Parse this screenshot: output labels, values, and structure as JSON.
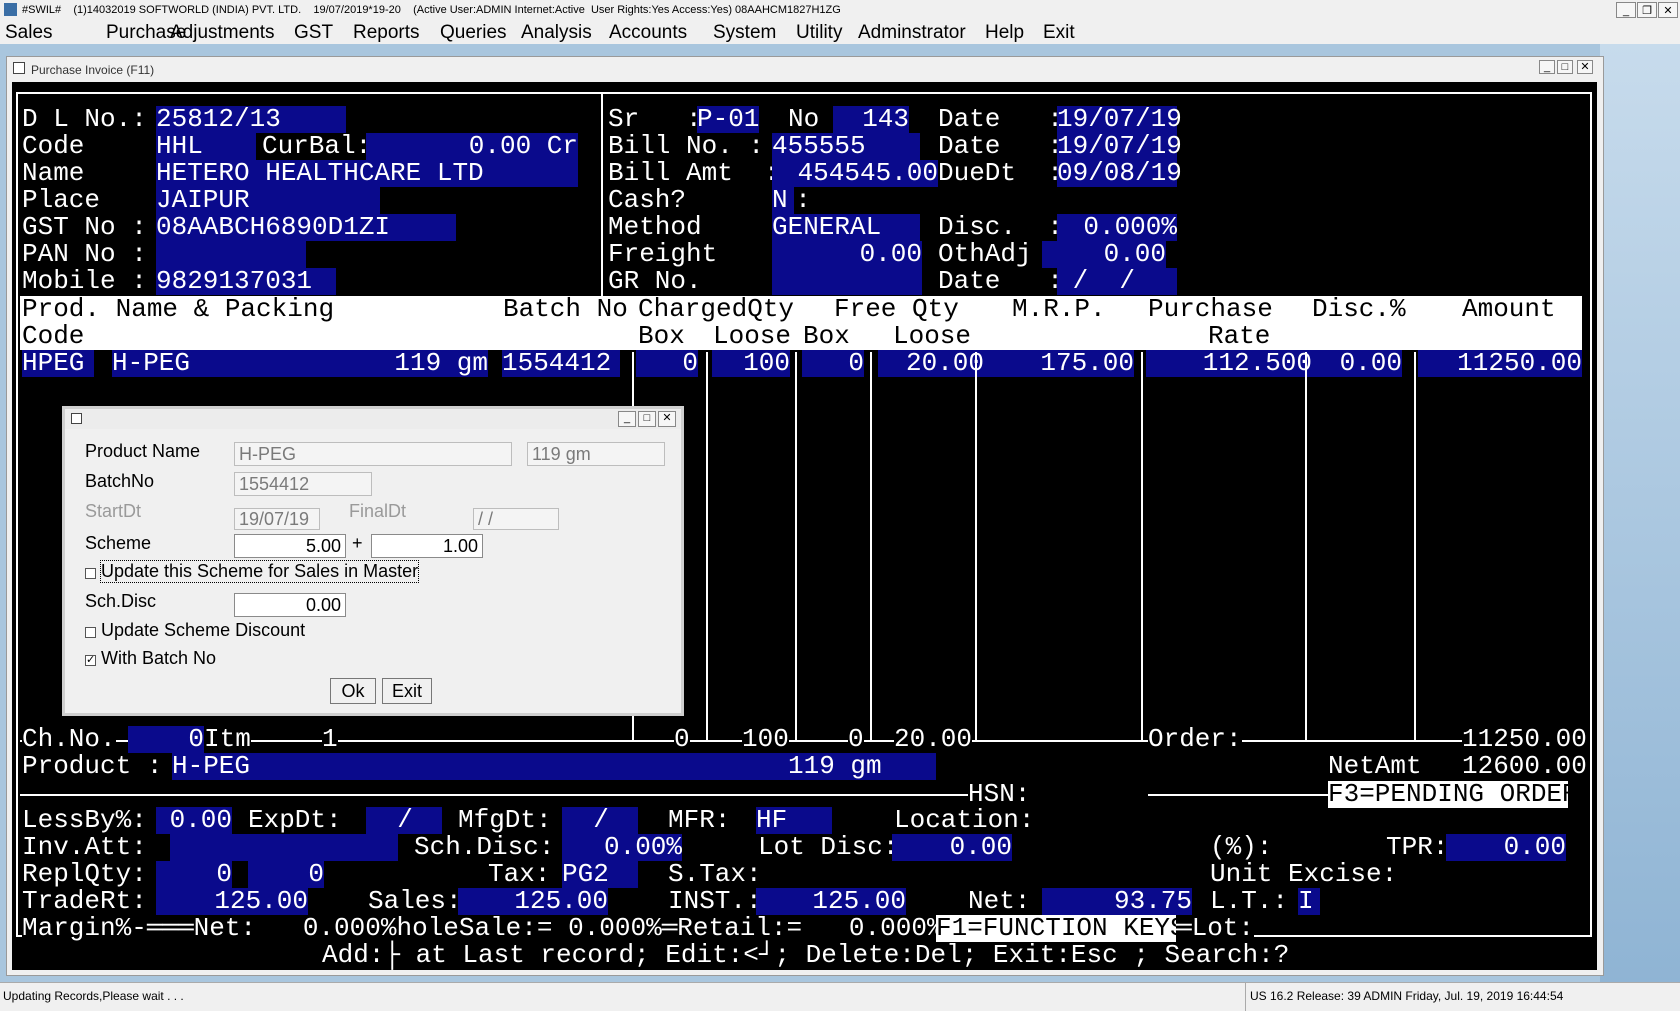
{
  "window": {
    "title": "#SWIL#    (1)14032019 SOFTWORLD (INDIA) PVT. LTD.    19/07/2019*19-20    (Active User:ADMIN Internet:Active  User Rights:Yes Access:Yes) 08AAHCM1827H1ZG",
    "min": "_",
    "restore": "❐",
    "close": "✕"
  },
  "menu": [
    "Sales",
    "Purchase",
    "Adjustments",
    "GST",
    "Reports",
    "Queries",
    "Analysis",
    "Accounts",
    "System",
    "Utility",
    "Adminstrator",
    "Help",
    "Exit"
  ],
  "child": {
    "title": "Purchase Invoice   (F11)",
    "min": "_",
    "max": "□",
    "close": "✕"
  },
  "header": {
    "dl_label": "D L No.:",
    "dl": "25812/13",
    "code_label": "Code     :",
    "code": "HHL",
    "curbal_label": "CurBal:",
    "curbal": "0.00 Cr",
    "name_label": "Name     :",
    "name": "HETERO HEALTHCARE LTD",
    "place_label": "Place    :",
    "place": "JAIPUR",
    "gst_label": "GST No :",
    "gst": "08AABCH6890D1ZI",
    "pan_label": "PAN No :",
    "mobile_label": "Mobile :",
    "mobile": "9829137031",
    "sr_label": "Sr   :",
    "sr": "P-01",
    "no_label": "No",
    "no": "143",
    "date_label": "Date   :",
    "date": "19/07/19",
    "billno_label": "Bill No. :",
    "billno": "455555",
    "date2_label": "Date   :",
    "date2": "19/07/19",
    "billamt_label": "Bill Amt  :",
    "billamt": "454545.00",
    "duedt_label": "DueDt  :",
    "duedt": "09/08/19",
    "cash_label": "Cash?       :",
    "cash": "N",
    "method_label": "Method     :",
    "method": "GENERAL",
    "disc_label": "Disc.  :",
    "disc": "0.000%",
    "freight_label": "Freight     :",
    "freight": "0.00",
    "othadj_label": "OthAdj",
    "othadj": "0.00",
    "grno_label": "GR No.      :",
    "date3_label": "Date   :",
    "date3": " /  /"
  },
  "grid": {
    "h1": [
      "Prod. Name & Packing",
      "Batch No",
      "ChargedQty",
      "Free Qty",
      "M.R.P.",
      "Purchase",
      "Disc.%",
      "Amount"
    ],
    "h2": [
      "Code",
      "Box",
      "Loose",
      "Box",
      "Loose",
      "Rate"
    ],
    "row": {
      "code": "HPEG",
      "name": "H-PEG",
      "pack": "119 gm",
      "batch": "1554412",
      "cbox": "0",
      "cloose": "100",
      "fbox": "0",
      "floose": "20.00",
      "mrp": "175.00",
      "rate": "112.500",
      "disc": "0.00",
      "amount": "11250.00"
    }
  },
  "dialog": {
    "product_label": "Product Name",
    "product": "H-PEG",
    "pack": "119 gm",
    "batch_label": "BatchNo",
    "batch": "1554412",
    "start_label": "StartDt",
    "start": "19/07/19",
    "final_label": "FinalDt",
    "final": " /  /",
    "scheme_label": "Scheme",
    "scheme1": "5.00",
    "plus": "+",
    "scheme2": "1.00",
    "upd_scheme": "Update this Scheme for Sales in Master",
    "schdisc_label": "Sch.Disc",
    "schdisc": "0.00",
    "upd_disc": "Update Scheme Discount",
    "with_batch": "With Batch No",
    "ok": "Ok",
    "exit": "Exit"
  },
  "footer": {
    "chno": "Ch.No.",
    "chval": "0",
    "itm": "Itm",
    "itmval": "1",
    "t_cbox": "0",
    "t_cloose": "100",
    "t_fbox": "0",
    "t_floose": "20.00",
    "order_label": "Order:",
    "order_total": "11250.00",
    "product_label": "Product :",
    "product": "H-PEG",
    "pack": "119 gm",
    "netamt_label": "NetAmt",
    "netamt": "12600.00",
    "hsn_label": "HSN:",
    "f3": "F3=PENDING ORDER",
    "lessby_label": "LessBy%:",
    "lessby": "0.00",
    "expdt_label": "ExpDt:",
    "expdt": "  /",
    "mfgdt_label": "MfgDt:",
    "mfgdt": "  /",
    "mfr_label": "MFR:",
    "mfr": "HF",
    "location_label": "Location:",
    "invatt_label": "Inv.Att:",
    "schdisc_label": "Sch.Disc:",
    "schdisc": "0.00%",
    "lotdisc_label": "Lot Disc:",
    "lotdisc": "0.00",
    "pct_label": "(%):",
    "tpr_label": "TPR:",
    "tpr": "0.00",
    "replqty_label": "ReplQty:",
    "repl1": "0",
    "repl2": "0",
    "tax_label": "Tax:",
    "tax": "PG2",
    "stax_label": "S.Tax:",
    "unitexcise_label": "Unit Excise:",
    "tradert_label": "TradeRt:",
    "tradert": "125.00",
    "sales_label": "Sales:",
    "sales": "125.00",
    "inst_label": "INST.:",
    "inst": "125.00",
    "net_label": "Net:",
    "net": "93.75",
    "lt_label": "L.T.:",
    "lt": "I",
    "margin_line": "Margin%-═══Net:   0.000%holeSale:= 0.000%═Retail:=   0.000%",
    "f1": "F1=FUNCTION KEYS",
    "lot_label": "═Lot:",
    "hint": "Add:├ at Last record; Edit:<┘; Delete:Del; Exit:Esc ; Search:?"
  },
  "status": {
    "left": "Updating Records,Please wait . . .",
    "right": "US 16.2 Release: 39 ADMIN  Friday, Jul. 19, 2019  16:44:54"
  }
}
